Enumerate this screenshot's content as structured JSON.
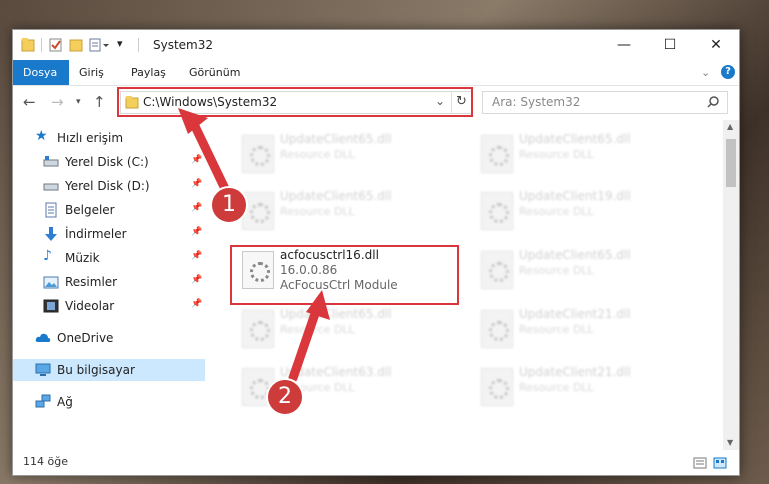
{
  "window": {
    "title": "System32",
    "controls": {
      "minimize": "—",
      "maximize": "☐",
      "close": "✕"
    }
  },
  "ribbon": {
    "tabs": [
      {
        "label": "Dosya"
      },
      {
        "label": "Giriş"
      },
      {
        "label": "Paylaş"
      },
      {
        "label": "Görünüm"
      }
    ],
    "help_icon": "?",
    "expand_icon": "⌄"
  },
  "nav": {
    "address": "C:\\Windows\\System32",
    "search_placeholder": "Ara: System32"
  },
  "sidebar": {
    "items": [
      {
        "label": "Hızlı erişim"
      },
      {
        "label": "Yerel Disk (C:)"
      },
      {
        "label": "Yerel Disk (D:)"
      },
      {
        "label": "Belgeler"
      },
      {
        "label": "İndirmeler"
      },
      {
        "label": "Müzik"
      },
      {
        "label": "Resimler"
      },
      {
        "label": "Videolar"
      },
      {
        "label": "OneDrive"
      },
      {
        "label": "Bu bilgisayar"
      },
      {
        "label": "Ağ"
      }
    ]
  },
  "files": {
    "left": [
      {
        "name": "UpdateClient65.dll",
        "desc": "Resource DLL"
      },
      {
        "name": "UpdateClient65.dll",
        "desc": "Resource DLL"
      },
      {
        "name": "UpdateClient65.dll",
        "desc": "Resource DLL"
      },
      {
        "name": "UpdateClient63.dll",
        "desc": "Resource DLL"
      }
    ],
    "right": [
      {
        "name": "UpdateClient65.dll",
        "desc": "Resource DLL"
      },
      {
        "name": "UpdateClient19.dll",
        "desc": "Resource DLL"
      },
      {
        "name": "UpdateClient65.dll",
        "desc": "Resource DLL"
      },
      {
        "name": "UpdateClient21.dll",
        "desc": "Resource DLL"
      },
      {
        "name": "UpdateClient21.dll",
        "desc": "Resource DLL"
      }
    ],
    "highlighted": {
      "name": "acfocusctrl16.dll",
      "version": "16.0.0.86",
      "desc": "AcFocusCtrl Module"
    }
  },
  "status": {
    "count": "114 öğe"
  },
  "callouts": {
    "one": "1",
    "two": "2"
  },
  "colors": {
    "accent": "#1979ca",
    "highlight": "#d9373b",
    "callout": "#cd3b3b",
    "selected": "#cce8ff"
  }
}
